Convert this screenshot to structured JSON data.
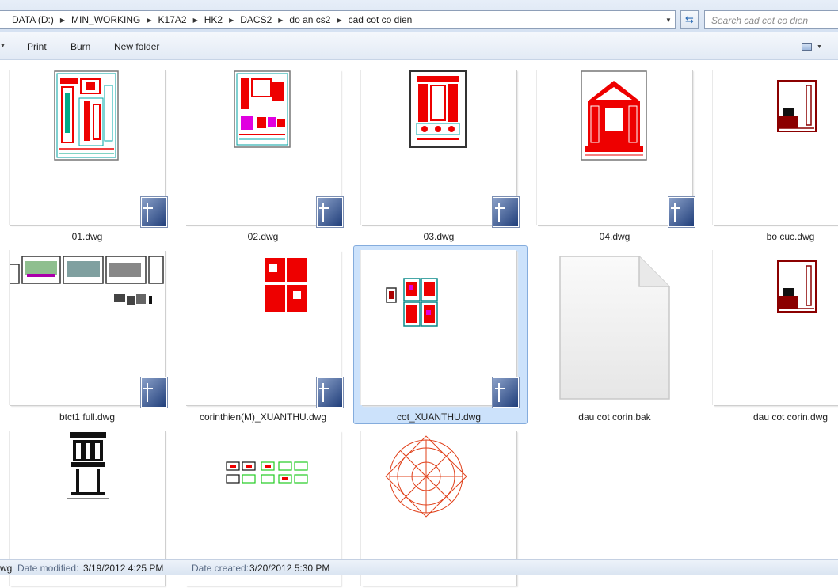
{
  "address": {
    "crumbs": [
      "DATA (D:)",
      "MIN_WORKING",
      "K17A2",
      "HK2",
      "DACS2",
      "do an cs2",
      "cad cot co dien"
    ]
  },
  "search": {
    "placeholder": "Search cad cot co dien"
  },
  "toolbar": {
    "print": "Print",
    "burn": "Burn",
    "new_folder": "New folder"
  },
  "files": [
    {
      "name": "01.dwg"
    },
    {
      "name": "02.dwg"
    },
    {
      "name": "03.dwg"
    },
    {
      "name": "04.dwg"
    },
    {
      "name": "bo cuc.dwg"
    },
    {
      "name": "btct1 full.dwg"
    },
    {
      "name": "corinthien(M)_XUANTHU.dwg"
    },
    {
      "name": "cot_XUANTHU.dwg",
      "selected": true
    },
    {
      "name": "dau cot corin.bak"
    },
    {
      "name": "dau cot corin.dwg"
    }
  ],
  "status": {
    "name_fragment": "wg",
    "modified_label": "Date modified:",
    "modified_value": "3/19/2012 4:25 PM",
    "created_label": "Date created:",
    "created_value": "3/20/2012 5:30 PM"
  },
  "colors": {
    "accent": "#cce2fb",
    "cad_red": "#ff0000",
    "cad_dark_red": "#8b0000",
    "cad_orange": "#e0401a"
  }
}
